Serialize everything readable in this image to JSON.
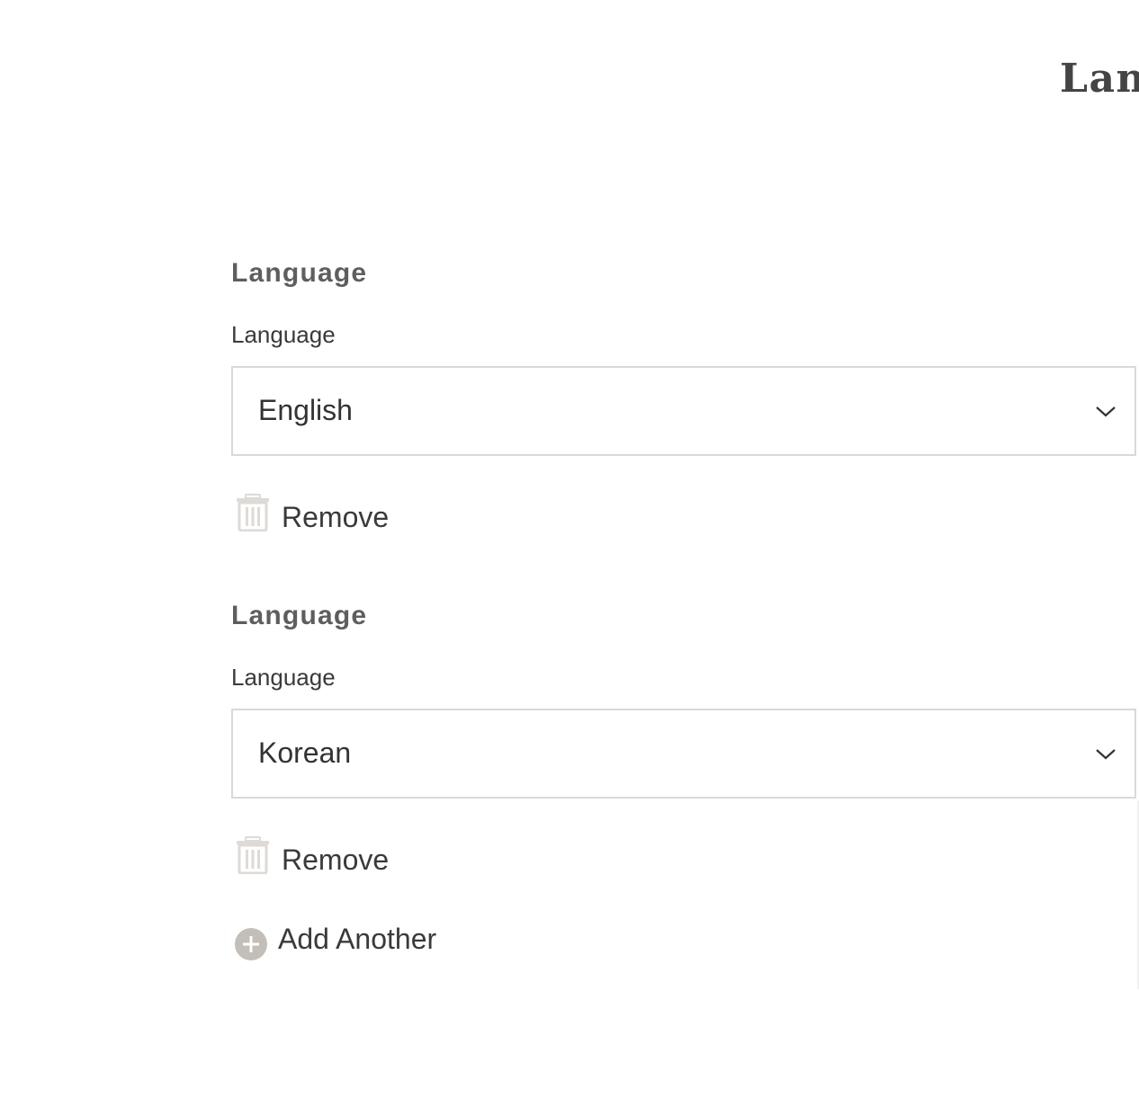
{
  "page": {
    "title": "Languages"
  },
  "entries": [
    {
      "heading": "Language",
      "field_label": "Language",
      "selected_value": "English",
      "remove_label": "Remove"
    },
    {
      "heading": "Language",
      "field_label": "Language",
      "selected_value": "Korean",
      "remove_label": "Remove"
    }
  ],
  "actions": {
    "add_another_label": "Add Another"
  },
  "icons": {
    "select_chevron": "chevron-down-icon",
    "remove": "trash-icon",
    "add": "plus-circle-icon"
  },
  "colors": {
    "icon_gray": "#c4beb8",
    "border": "#d9d9d9",
    "text": "#333333",
    "heading": "#5e5e5e"
  }
}
